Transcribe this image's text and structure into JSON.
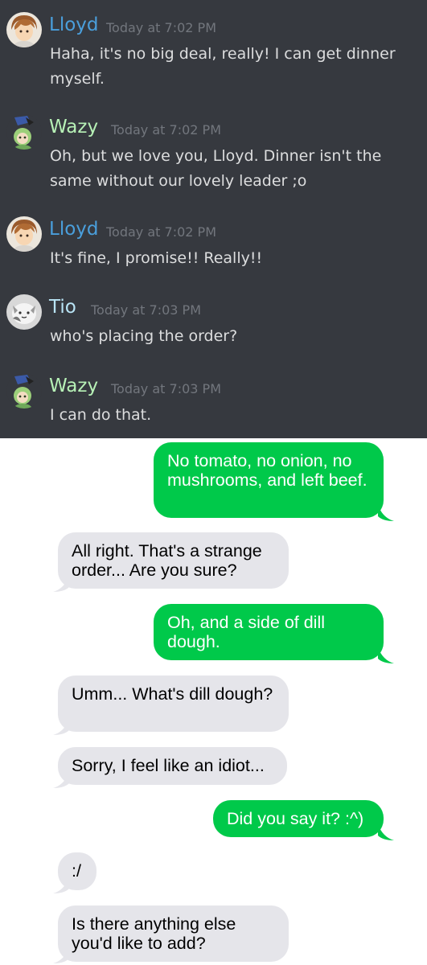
{
  "discord": {
    "messages": [
      {
        "user": "Lloyd",
        "name_color": "#4a9fdc",
        "time": "Today at 7:02 PM",
        "text": "Haha, it's no big deal, really! I can get dinner myself.",
        "avatar": "lloyd-avatar-icon"
      },
      {
        "user": "Wazy",
        "name_color": "#b7f1b6",
        "time": "Today at 7:02 PM",
        "text": "Oh, but we love you, Lloyd. Dinner isn't the same without our lovely leader ;o",
        "avatar": "wazy-avatar-icon"
      },
      {
        "user": "Lloyd",
        "name_color": "#4a9fdc",
        "time": "Today at 7:02 PM",
        "text": "It's fine, I promise!! Really!!",
        "avatar": "lloyd-avatar-icon"
      },
      {
        "user": "Tio",
        "name_color": "#b9e4f5",
        "time": "Today at 7:03 PM",
        "text": "who's placing the order?",
        "avatar": "tio-avatar-icon"
      },
      {
        "user": "Wazy",
        "name_color": "#b7f1b6",
        "time": "Today at 7:03 PM",
        "text": "I can do that.",
        "avatar": "wazy-avatar-icon"
      }
    ]
  },
  "sms": {
    "colors": {
      "outgoing": "#00c94a",
      "incoming": "#e5e5ea"
    },
    "messages": [
      {
        "dir": "out",
        "text": "No tomato, no onion, no mushrooms, and left beef."
      },
      {
        "dir": "in",
        "text": "All right. That's a strange order... Are you sure?"
      },
      {
        "dir": "out",
        "text": "Oh, and a side of dill dough."
      },
      {
        "dir": "in",
        "text": "Umm... What's dill dough?"
      },
      {
        "dir": "in",
        "text": "Sorry, I feel like an idiot..."
      },
      {
        "dir": "out",
        "text": "Did you say it? :^)"
      },
      {
        "dir": "in",
        "text": ":/"
      },
      {
        "dir": "in",
        "text": "Is there anything else you'd like to add?"
      }
    ]
  }
}
